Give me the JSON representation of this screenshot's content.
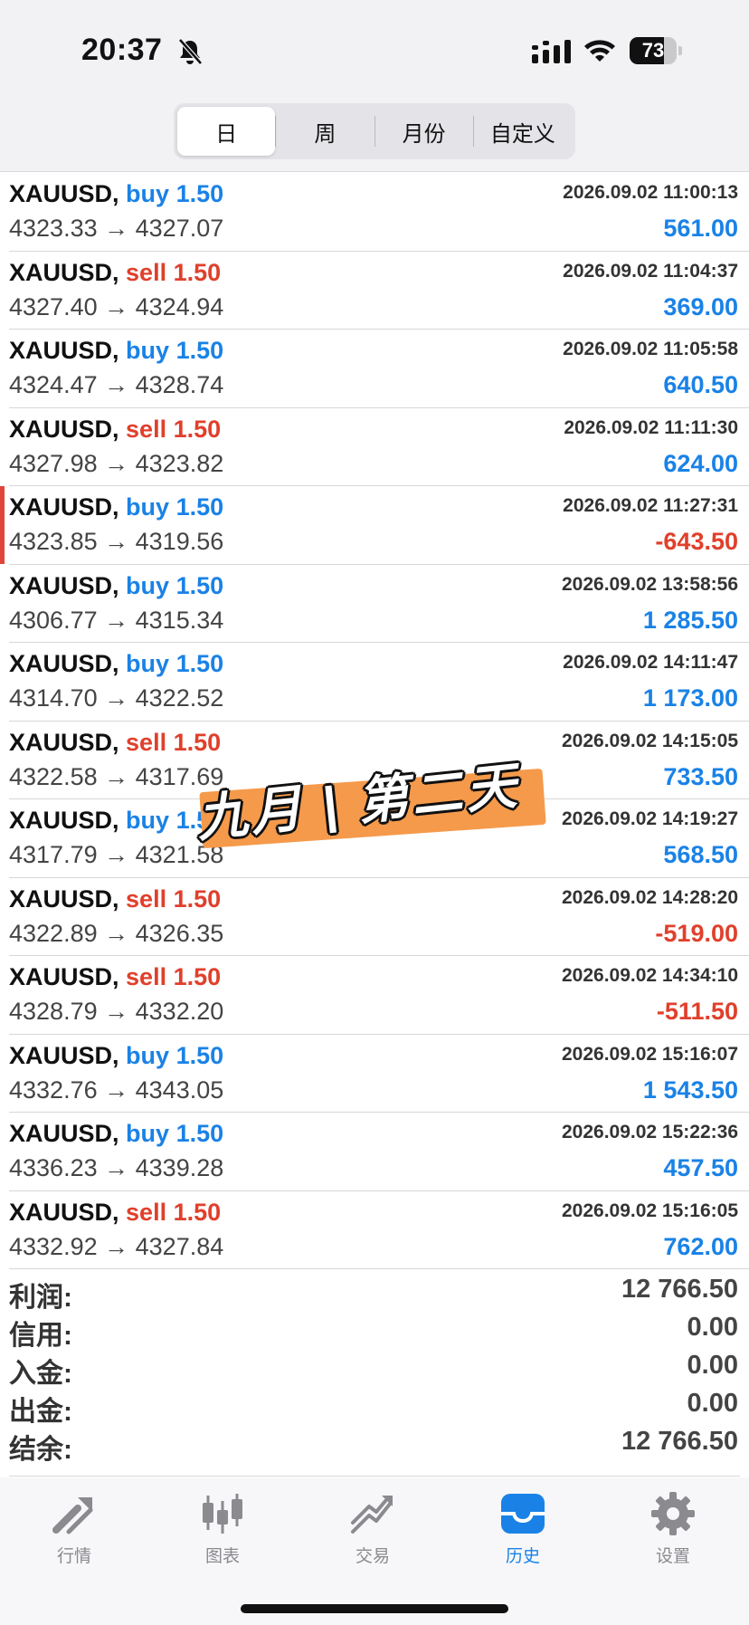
{
  "status": {
    "time": "20:37",
    "battery": "73",
    "battery_level": 0.73
  },
  "tabs": [
    {
      "label": "日",
      "active": true
    },
    {
      "label": "周",
      "active": false
    },
    {
      "label": "月份",
      "active": false
    },
    {
      "label": "自定义",
      "active": false
    }
  ],
  "trades": [
    {
      "symbol": "XAUUSD,",
      "side": "buy",
      "volume": "1.50",
      "datetime": "2026.09.02 11:00:13",
      "open": "4323.33",
      "close": "4327.07",
      "profit": "561.00"
    },
    {
      "symbol": "XAUUSD,",
      "side": "sell",
      "volume": "1.50",
      "datetime": "2026.09.02 11:04:37",
      "open": "4327.40",
      "close": "4324.94",
      "profit": "369.00"
    },
    {
      "symbol": "XAUUSD,",
      "side": "buy",
      "volume": "1.50",
      "datetime": "2026.09.02 11:05:58",
      "open": "4324.47",
      "close": "4328.74",
      "profit": "640.50"
    },
    {
      "symbol": "XAUUSD,",
      "side": "sell",
      "volume": "1.50",
      "datetime": "2026.09.02 11:11:30",
      "open": "4327.98",
      "close": "4323.82",
      "profit": "624.00"
    },
    {
      "symbol": "XAUUSD,",
      "side": "buy",
      "volume": "1.50",
      "datetime": "2026.09.02 11:27:31",
      "open": "4323.85",
      "close": "4319.56",
      "profit": "-643.50"
    },
    {
      "symbol": "XAUUSD,",
      "side": "buy",
      "volume": "1.50",
      "datetime": "2026.09.02 13:58:56",
      "open": "4306.77",
      "close": "4315.34",
      "profit": "1 285.50"
    },
    {
      "symbol": "XAUUSD,",
      "side": "buy",
      "volume": "1.50",
      "datetime": "2026.09.02 14:11:47",
      "open": "4314.70",
      "close": "4322.52",
      "profit": "1 173.00"
    },
    {
      "symbol": "XAUUSD,",
      "side": "sell",
      "volume": "1.50",
      "datetime": "2026.09.02 14:15:05",
      "open": "4322.58",
      "close": "4317.69",
      "profit": "733.50"
    },
    {
      "symbol": "XAUUSD,",
      "side": "buy",
      "volume": "1.50",
      "datetime": "2026.09.02 14:19:27",
      "open": "4317.79",
      "close": "4321.58",
      "profit": "568.50"
    },
    {
      "symbol": "XAUUSD,",
      "side": "sell",
      "volume": "1.50",
      "datetime": "2026.09.02 14:28:20",
      "open": "4322.89",
      "close": "4326.35",
      "profit": "-519.00"
    },
    {
      "symbol": "XAUUSD,",
      "side": "sell",
      "volume": "1.50",
      "datetime": "2026.09.02 14:34:10",
      "open": "4328.79",
      "close": "4332.20",
      "profit": "-511.50"
    },
    {
      "symbol": "XAUUSD,",
      "side": "buy",
      "volume": "1.50",
      "datetime": "2026.09.02 15:16:07",
      "open": "4332.76",
      "close": "4343.05",
      "profit": "1 543.50"
    },
    {
      "symbol": "XAUUSD,",
      "side": "buy",
      "volume": "1.50",
      "datetime": "2026.09.02 15:22:36",
      "open": "4336.23",
      "close": "4339.28",
      "profit": "457.50"
    },
    {
      "symbol": "XAUUSD,",
      "side": "sell",
      "volume": "1.50",
      "datetime": "2026.09.02 15:16:05",
      "open": "4332.92",
      "close": "4327.84",
      "profit": "762.00"
    }
  ],
  "arrow": "→",
  "summary": [
    {
      "label": "利润:",
      "value": "12 766.50"
    },
    {
      "label": "信用:",
      "value": "0.00"
    },
    {
      "label": "入金:",
      "value": "0.00"
    },
    {
      "label": "出金:",
      "value": "0.00"
    },
    {
      "label": "结余:",
      "value": "12 766.50"
    }
  ],
  "overlay": {
    "text": "九月 | 第二天"
  },
  "bottom_tabs": [
    {
      "label": "行情",
      "icon": "quotes-icon",
      "active": false
    },
    {
      "label": "图表",
      "icon": "chart-candles-icon",
      "active": false
    },
    {
      "label": "交易",
      "icon": "trade-icon",
      "active": false
    },
    {
      "label": "历史",
      "icon": "history-inbox-icon",
      "active": true
    },
    {
      "label": "设置",
      "icon": "gear-icon",
      "active": false
    }
  ],
  "colors": {
    "buy": "#1a82e6",
    "sell": "#e0402c",
    "accent": "#1a82e6",
    "overlay": "#f59a4b"
  }
}
